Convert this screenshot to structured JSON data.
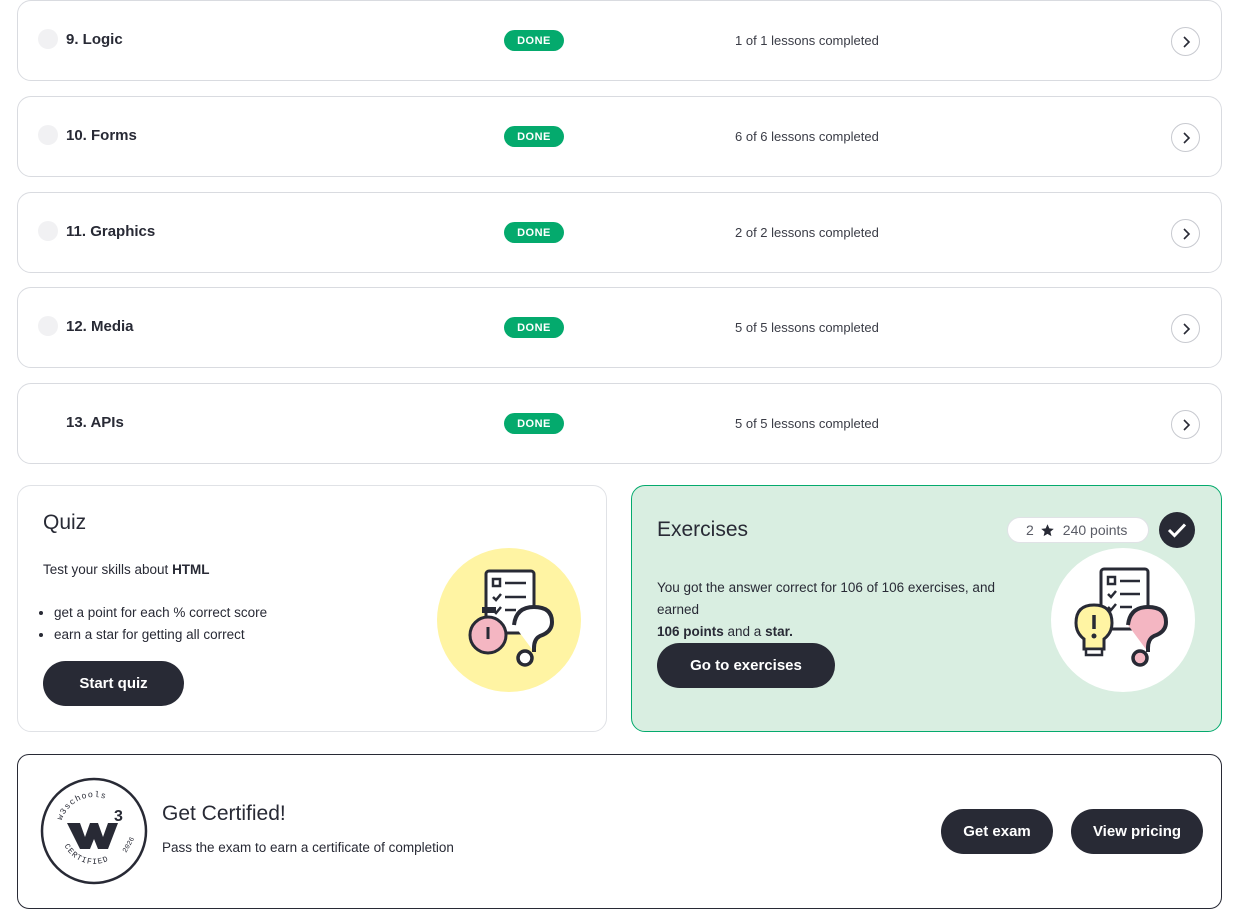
{
  "modules": [
    {
      "title": "9. Logic",
      "status": "DONE",
      "progress": "1 of 1 lessons completed"
    },
    {
      "title": "10. Forms",
      "status": "DONE",
      "progress": "6 of 6 lessons completed"
    },
    {
      "title": "11. Graphics",
      "status": "DONE",
      "progress": "2 of 2 lessons completed"
    },
    {
      "title": "12. Media",
      "status": "DONE",
      "progress": "5 of 5 lessons completed"
    },
    {
      "title": "13. APIs",
      "status": "DONE",
      "progress": "5 of 5 lessons completed"
    }
  ],
  "quiz": {
    "title": "Quiz",
    "description_prefix": "Test your skills about ",
    "description_topic": "HTML",
    "bullets": [
      "get a point for each % correct score",
      "earn a star for getting all correct"
    ],
    "button": "Start quiz"
  },
  "exercises": {
    "title": "Exercises",
    "stars": "2",
    "points": "240 points",
    "text_1": "You got the answer correct for 106 of 106 exercises, and earned",
    "points_earned": "106 points",
    "text_2": " and a ",
    "star_word": "star.",
    "button": "Go to exercises"
  },
  "certified": {
    "title": "Get Certified!",
    "description": "Pass the exam to earn a certificate of completion",
    "exam_button": "Get exam",
    "pricing_button": "View pricing",
    "badge_top": "w3schools",
    "badge_bottom": "CERTIFIED",
    "badge_year": "2026",
    "badge_sup": "3"
  },
  "colors": {
    "done_green": "#04aa6d",
    "dark": "#282a35",
    "exercises_bg": "#d9eee1",
    "quiz_circle": "#fff4a3",
    "pink": "#f4b6c2"
  }
}
